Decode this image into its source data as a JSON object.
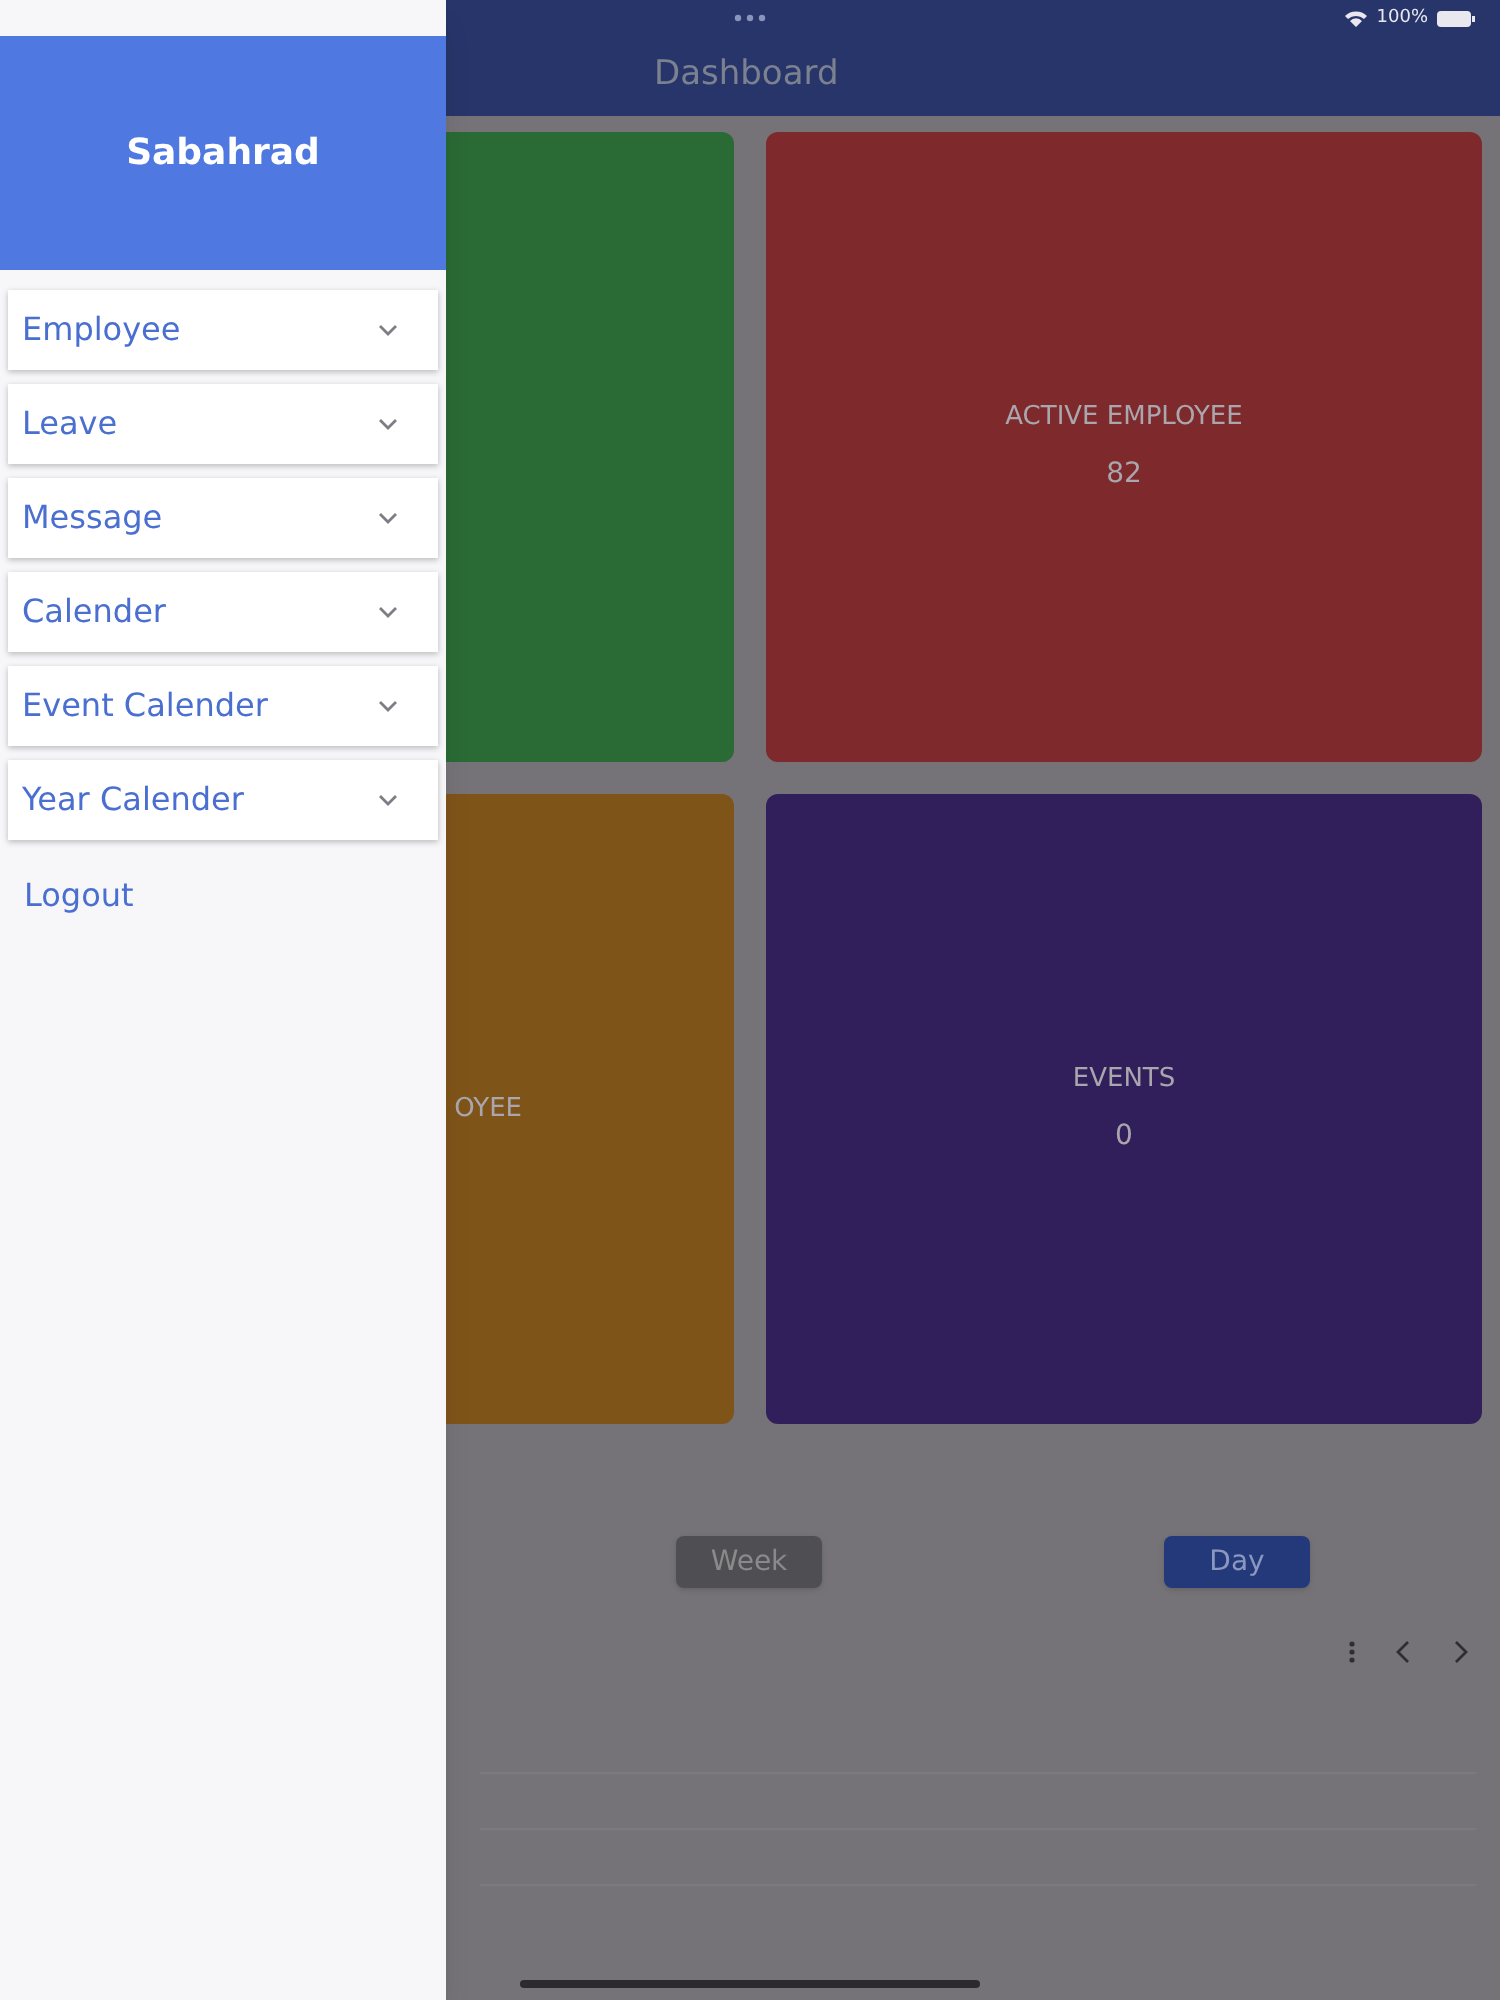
{
  "status_bar": {
    "battery": "100%"
  },
  "header": {
    "title": "Dashboard"
  },
  "cards": [
    {
      "color": "#2a6a35"
    },
    {
      "label": "ACTIVE EMPLOYEE",
      "value": "82",
      "color": "#7e2a2c"
    },
    {
      "label": "OYEE",
      "color": "#7f5419"
    },
    {
      "label": "EVENTS",
      "value": "0",
      "color": "#311f5b"
    }
  ],
  "view_buttons": [
    {
      "label": "Week",
      "selected": false
    },
    {
      "label": "Day",
      "selected": true
    }
  ],
  "drawer": {
    "user_name": "Sabahrad",
    "items": [
      {
        "label": "Employee",
        "expanded": false
      },
      {
        "label": "Leave",
        "expanded": false
      },
      {
        "label": "Message",
        "expanded": false
      },
      {
        "label": "Calender",
        "expanded": false
      },
      {
        "label": "Event Calender",
        "expanded": false
      },
      {
        "label": "Year Calender",
        "expanded": false
      }
    ],
    "logout": "Logout"
  }
}
